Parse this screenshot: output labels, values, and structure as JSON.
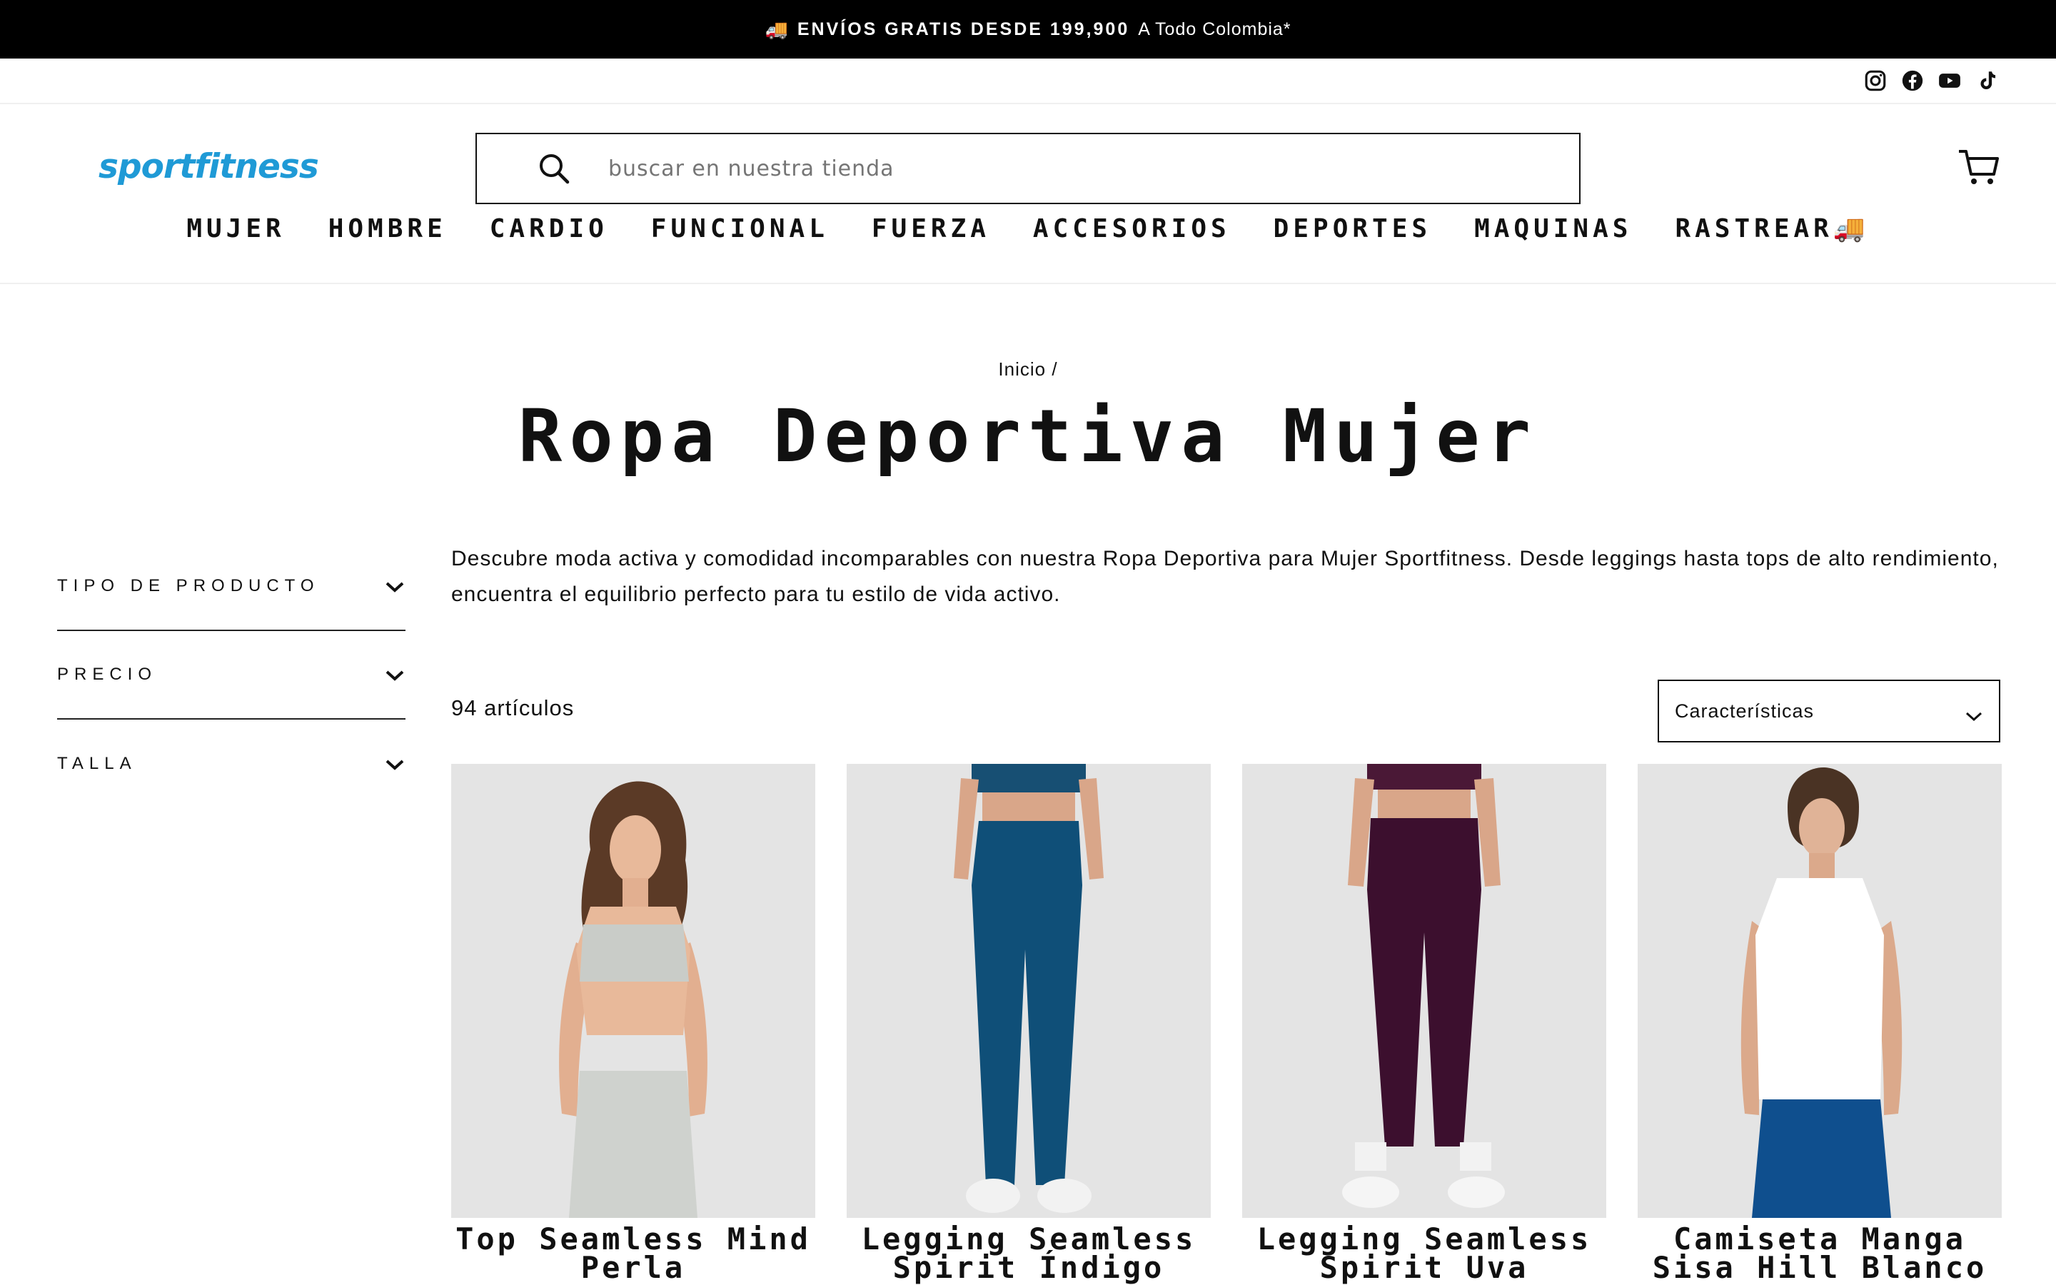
{
  "announcement": {
    "emoji": "🚚",
    "bold_text": "ENVÍOS GRATIS DESDE 199,900",
    "light_text": "A Todo Colombia*"
  },
  "social": [
    "instagram-icon",
    "facebook-icon",
    "youtube-icon",
    "tiktok-icon"
  ],
  "brand": {
    "logo_text": "sportfitness",
    "color": "#1f9ad6"
  },
  "search": {
    "placeholder": "buscar en nuestra tienda"
  },
  "nav": [
    "MUJER",
    "HOMBRE",
    "CARDIO",
    "FUNCIONAL",
    "FUERZA",
    "ACCESORIOS",
    "DEPORTES",
    "MAQUINAS",
    "RASTREAR🚚"
  ],
  "breadcrumb": "Inicio /",
  "page_title": "Ropa Deportiva Mujer",
  "filters": [
    "TIPO DE PRODUCTO",
    "PRECIO",
    "TALLA"
  ],
  "description": "Descubre moda activa y comodidad incomparables con nuestra Ropa Deportiva para Mujer Sportfitness. Desde leggings hasta tops de alto rendimiento, encuentra el equilibrio perfecto para tu estilo de vida activo.",
  "item_count": "94 artículos",
  "sort": {
    "selected": "Características"
  },
  "products": [
    {
      "name": "Top Seamless Mind Perla"
    },
    {
      "name": "Legging Seamless Spirit Índigo"
    },
    {
      "name": "Legging Seamless Spirit Uva"
    },
    {
      "name": "Camiseta Manga Sisa Hill Blanco"
    }
  ]
}
